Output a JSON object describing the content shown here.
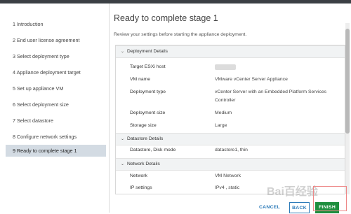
{
  "steps": [
    {
      "label": "1  Introduction"
    },
    {
      "label": "2  End user license agreement"
    },
    {
      "label": "3  Select deployment type"
    },
    {
      "label": "4  Appliance deployment target"
    },
    {
      "label": "5  Set up appliance VM"
    },
    {
      "label": "6  Select deployment size"
    },
    {
      "label": "7  Select datastore"
    },
    {
      "label": "8  Configure network settings"
    },
    {
      "label": "9  Ready to complete stage 1"
    }
  ],
  "main": {
    "title": "Ready to complete stage 1",
    "subtitle": "Review your settings before starting the appliance deployment."
  },
  "sections": {
    "deployment": {
      "title": "Deployment Details",
      "rows": [
        {
          "label": "Target ESXi host",
          "value": ""
        },
        {
          "label": "VM name",
          "value": "VMware vCenter Server Appliance"
        },
        {
          "label": "Deployment type",
          "value": "vCenter Server with an Embedded Platform Services Controller"
        },
        {
          "label": "Deployment size",
          "value": "Medium"
        },
        {
          "label": "Storage size",
          "value": "Large"
        }
      ]
    },
    "datastore": {
      "title": "Datastore Details",
      "rows": [
        {
          "label": "Datastore, Disk mode",
          "value": "datastore1, thin"
        }
      ]
    },
    "network": {
      "title": "Network Details",
      "rows": [
        {
          "label": "Network",
          "value": "VM Network"
        },
        {
          "label": "IP settings",
          "value": "IPv4 , static"
        }
      ]
    }
  },
  "footer": {
    "cancel_label": "CANCEL",
    "back_label": "BACK",
    "finish_label": "FINISH"
  },
  "watermark": "Bai百经验"
}
